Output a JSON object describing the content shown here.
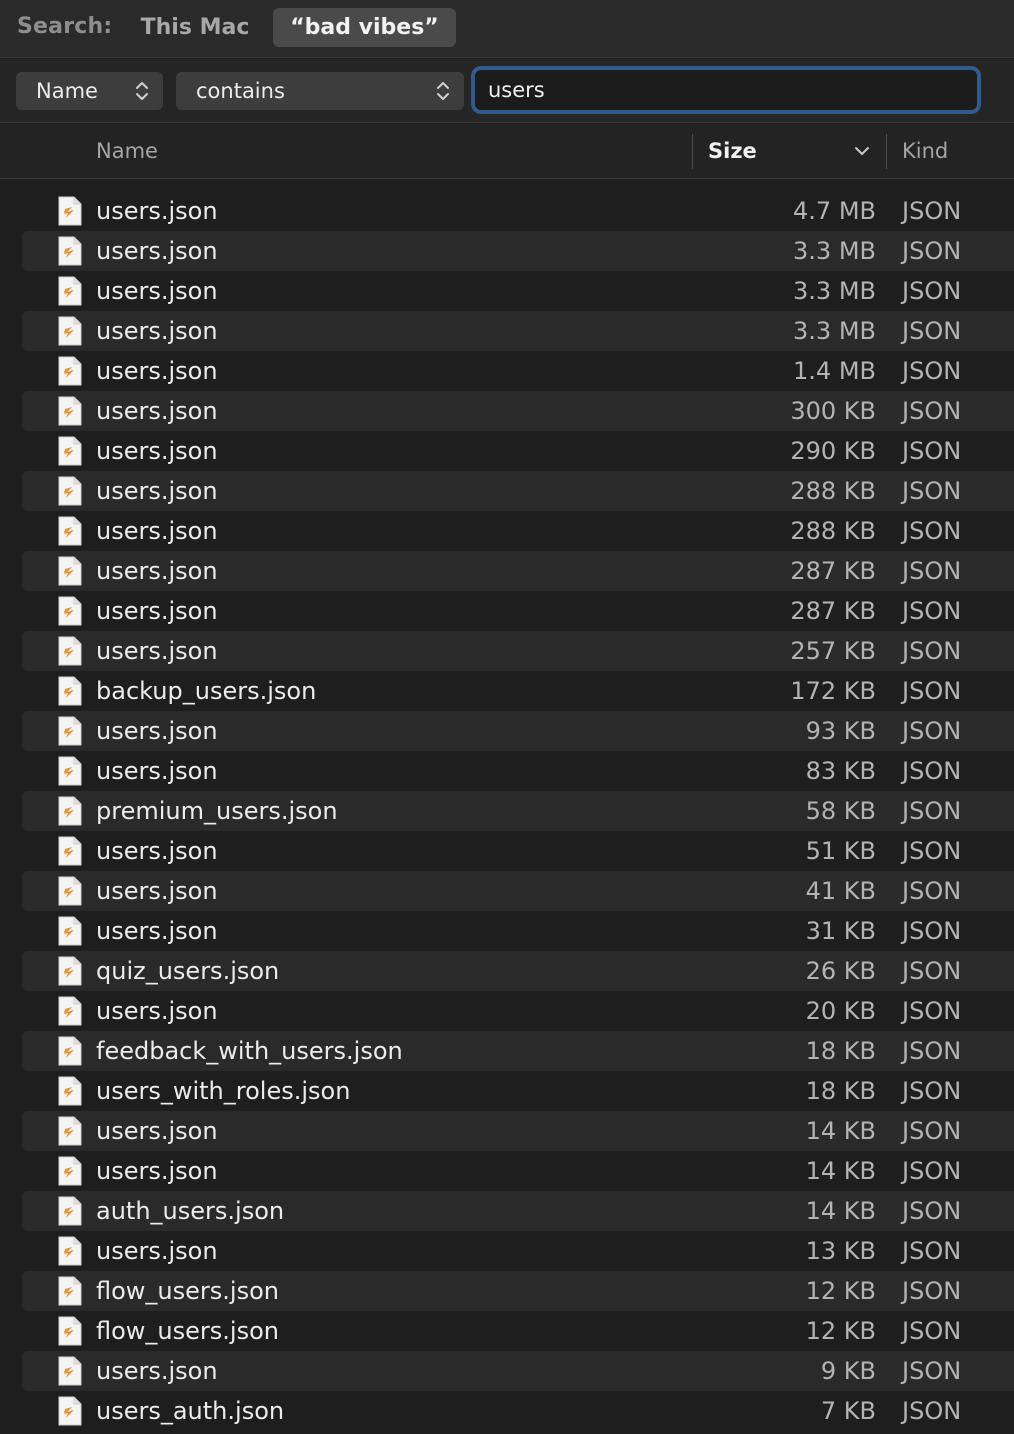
{
  "scope": {
    "label": "Search:",
    "this_mac": "This Mac",
    "folder": "“bad vibes”"
  },
  "criteria": {
    "attribute": "Name",
    "operator": "contains",
    "query": "users"
  },
  "columns": {
    "name": "Name",
    "size": "Size",
    "kind": "Kind"
  },
  "icons": {
    "file": "json-file-icon",
    "popup": "chevron-up-down-icon",
    "sort": "chevron-down-icon"
  },
  "colors": {
    "accent_focus": "#2f5b8d",
    "file_icon_mark": "#e8912d"
  },
  "files": [
    {
      "name": "users.json",
      "size": "4.7 MB",
      "kind": "JSON"
    },
    {
      "name": "users.json",
      "size": "3.3 MB",
      "kind": "JSON"
    },
    {
      "name": "users.json",
      "size": "3.3 MB",
      "kind": "JSON"
    },
    {
      "name": "users.json",
      "size": "3.3 MB",
      "kind": "JSON"
    },
    {
      "name": "users.json",
      "size": "1.4 MB",
      "kind": "JSON"
    },
    {
      "name": "users.json",
      "size": "300 KB",
      "kind": "JSON"
    },
    {
      "name": "users.json",
      "size": "290 KB",
      "kind": "JSON"
    },
    {
      "name": "users.json",
      "size": "288 KB",
      "kind": "JSON"
    },
    {
      "name": "users.json",
      "size": "288 KB",
      "kind": "JSON"
    },
    {
      "name": "users.json",
      "size": "287 KB",
      "kind": "JSON"
    },
    {
      "name": "users.json",
      "size": "287 KB",
      "kind": "JSON"
    },
    {
      "name": "users.json",
      "size": "257 KB",
      "kind": "JSON"
    },
    {
      "name": "backup_users.json",
      "size": "172 KB",
      "kind": "JSON"
    },
    {
      "name": "users.json",
      "size": "93 KB",
      "kind": "JSON"
    },
    {
      "name": "users.json",
      "size": "83 KB",
      "kind": "JSON"
    },
    {
      "name": "premium_users.json",
      "size": "58 KB",
      "kind": "JSON"
    },
    {
      "name": "users.json",
      "size": "51 KB",
      "kind": "JSON"
    },
    {
      "name": "users.json",
      "size": "41 KB",
      "kind": "JSON"
    },
    {
      "name": "users.json",
      "size": "31 KB",
      "kind": "JSON"
    },
    {
      "name": "quiz_users.json",
      "size": "26 KB",
      "kind": "JSON"
    },
    {
      "name": "users.json",
      "size": "20 KB",
      "kind": "JSON"
    },
    {
      "name": "feedback_with_users.json",
      "size": "18 KB",
      "kind": "JSON"
    },
    {
      "name": "users_with_roles.json",
      "size": "18 KB",
      "kind": "JSON"
    },
    {
      "name": "users.json",
      "size": "14 KB",
      "kind": "JSON"
    },
    {
      "name": "users.json",
      "size": "14 KB",
      "kind": "JSON"
    },
    {
      "name": "auth_users.json",
      "size": "14 KB",
      "kind": "JSON"
    },
    {
      "name": "users.json",
      "size": "13 KB",
      "kind": "JSON"
    },
    {
      "name": "flow_users.json",
      "size": "12 KB",
      "kind": "JSON"
    },
    {
      "name": "flow_users.json",
      "size": "12 KB",
      "kind": "JSON"
    },
    {
      "name": "users.json",
      "size": "9 KB",
      "kind": "JSON"
    },
    {
      "name": "users_auth.json",
      "size": "7 KB",
      "kind": "JSON"
    }
  ]
}
